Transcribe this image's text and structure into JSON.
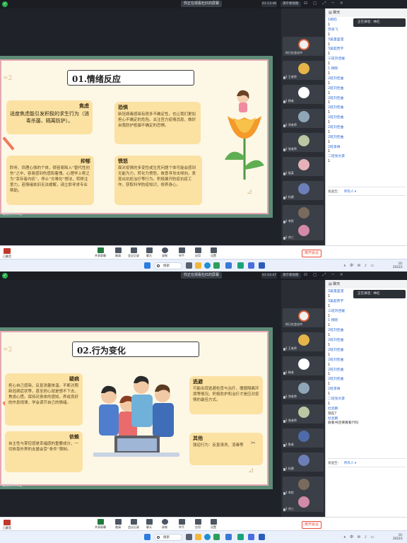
{
  "top": {
    "share_banner": "你正在观看杜红的屏幕",
    "timer": "01:13:46",
    "view_mode": "演示者视图",
    "slide": {
      "title": "01.情绪反应",
      "math_deco": "=2",
      "cards": [
        {
          "title": "焦虑",
          "body": "适度焦虑能引发积极的求生行为（消毒杀菌、隔离防护）。"
        },
        {
          "title": "恐惧",
          "body": "新冠病毒感染有很多不确定性，也让我们更加担心不确定的危险。关注官方疫情消息，做好自我防护抵御不确定的恐惧。"
        },
        {
          "title": "抑郁",
          "body": "聆听、同理心强的个体，很容易陷入“替代性创伤”之中，容易感到伤感和着愧。心理学上称之为“幸存者内疚”，停止“灾难化”想法，转移注意力，若情绪依旧无法缓解，请立即寻求专业帮助。"
        },
        {
          "title": "愤怒",
          "body": "面对疫情的多变性或生死问题个体可能会感到无能为力，转化为愤怒，故意寻攻击倾向，表现出抗拒治疗等行为。积极展开防疫抗疫工作，获取科学防疫知识，修养身心。"
        }
      ],
      "caption": "最近的什么..."
    },
    "participants": [
      "你已在会议中",
      "1 王老师",
      "1 杨老",
      "1 涂老师",
      "1 张老师",
      "1 侯某",
      "1 杜鹃",
      "1 李民",
      "1 刘三"
    ],
    "chat_messages": [
      "1杨钧",
      "1",
      "苏贡飞",
      "1",
      "3吴量盛漫",
      "1",
      "3吴超贾宇",
      "1",
      "三班刘佳媛",
      "1",
      "1 杨晓",
      "1",
      "2班刘佳曲",
      "1",
      "2班刘佳曲",
      "1",
      "2班刘佳曲",
      "1",
      "2班刘佳曲",
      "1",
      "2班刘佳曲",
      "1",
      "2班刘佳曲",
      "1",
      "2班刘佳曲",
      "1",
      "2班李靖",
      "1",
      "二班张文豪",
      "1"
    ],
    "private_chat": "正在讲话：林红",
    "send_to_label": "发送至：",
    "send_to_value": "所有人 ▾"
  },
  "bottom": {
    "share_banner": "你正在观看杜红的屏幕",
    "timer": "01:14:47",
    "view_mode": "演示者视图",
    "slide": {
      "title": "02.行为变化",
      "math_deco": "=2",
      "cards": [
        {
          "title": "疑病",
          "body": "担心自己感染，反复测量体温。不断对照新冠病症状等，甚至担心就是想不下去，焦虑心慌。保持对身体的感知，养成良好的作息规律，学会调节自己的情绪。"
        },
        {
          "title": "逃避",
          "body": "可能出现逃避检查与治疗，擅据隔离环境等情况。积极防护和治疗才是应对疫情的最佳方式。"
        },
        {
          "title": "依赖",
          "body": "自主性与掌控感是幸福感的重要成分，一切依靠外界的支援会受“条件”限制。"
        },
        {
          "title": "其他",
          "body": "强迫行为：反复清洗、消毒等"
        }
      ],
      "caption": "最近的什么..."
    },
    "participants": [
      "你已在会议中",
      "1 王老师",
      "1 杨老",
      "1 涂老师",
      "1 张老师",
      "1 陈老",
      "1 杜鹃",
      "1 李民",
      "1 刘三"
    ],
    "chat_messages": [
      "3吴量盛漫",
      "1",
      "3吴超贾宇",
      "1",
      "三班刘佳媛",
      "1",
      "1 杨晓",
      "1",
      "2班刘佳曲",
      "1",
      "2班刘佳曲",
      "1",
      "2班刘佳曲",
      "1",
      "2班刘佳曲",
      "1",
      "2班刘佳曲",
      "1",
      "2班刘佳曲",
      "1",
      "2班李靖",
      "1",
      "二班张文豪",
      "1",
      "杜亮鹏",
      "现在?",
      "杜亮鹏",
      "收看书还要再看行吗"
    ],
    "private_chat": "正在讲话：林红",
    "send_to_label": "发送至：",
    "send_to_value": "所有人 ▾"
  },
  "toolbar": {
    "left_label": "已静音",
    "items": [
      "共享屏幕",
      "邀请",
      "会议记录",
      "聊天",
      "录制",
      "举手",
      "应用",
      "设置"
    ],
    "end_button": "离开会议"
  },
  "taskbar": {
    "search": "搜索",
    "tray": "∧ 中 ✉ ♪ ▭",
    "time": "10:",
    "date": "2022/1"
  },
  "colors": {
    "accent": "#1f7a3f",
    "slide_frame": "#5e8c77",
    "card": "#fbe2a3",
    "end": "#e74c3c"
  }
}
